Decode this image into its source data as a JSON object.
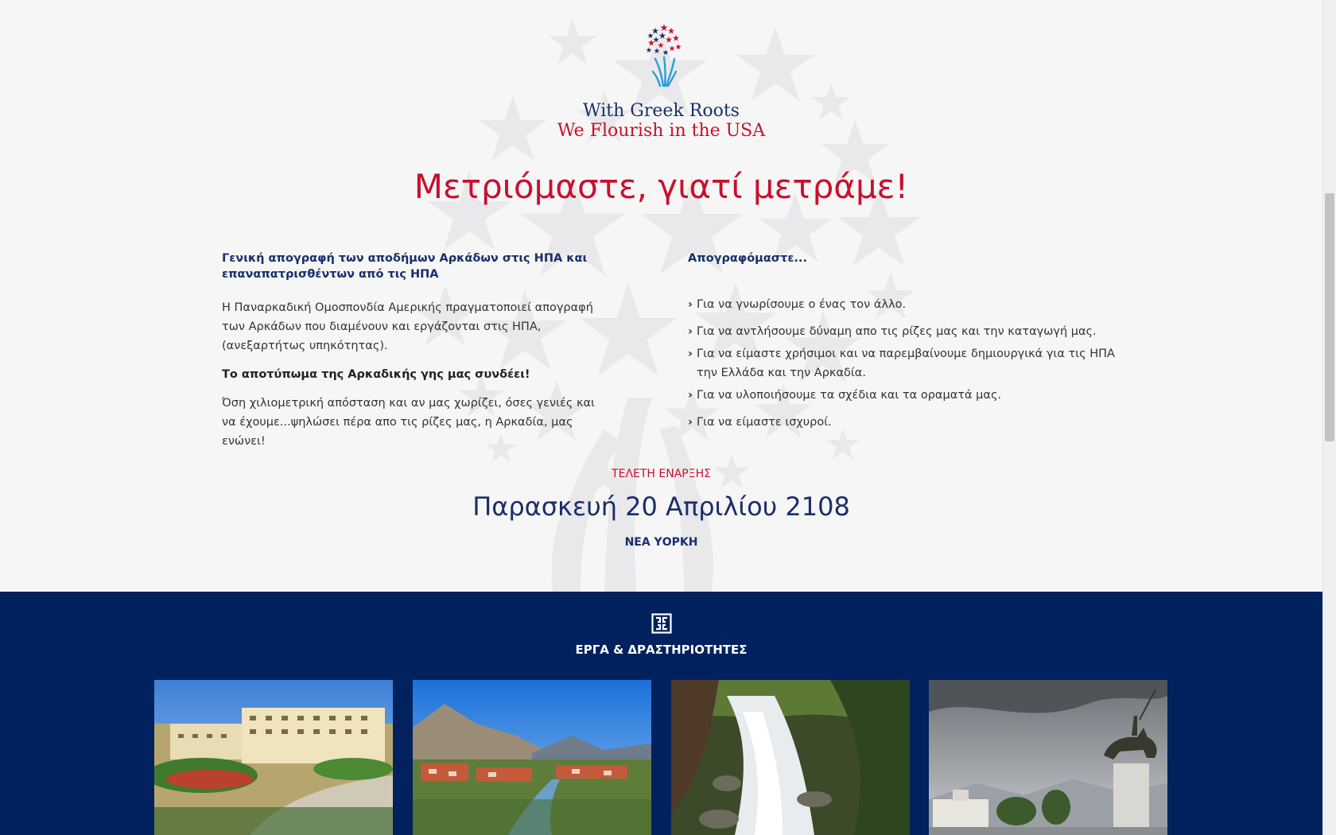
{
  "hero": {
    "tagline_line1": "With Greek Roots",
    "tagline_line2": "We Flourish in the USA",
    "headline": "Μετριόμαστε, γιατί μετράμε!"
  },
  "left_column": {
    "heading": "Γενική απογραφή των αποδήμων Αρκάδων στις ΗΠΑ και επαναπατρισθέντων από τις ΗΠΑ",
    "paragraph1": "Η Παναρκαδική Ομοσπονδία Αμερικής πραγματοποιεί απογραφή των Αρκάδων που διαμένουν και εργάζονται στις ΗΠΑ, (ανεξαρτήτως υπηκότητας).",
    "bold_line": "Το αποτύπωμα της Αρκαδικής γης μας συνδέει!",
    "paragraph2": "Όση χιλιομετρική απόσταση και αν μας χωρίζει, όσες γενιές και να έχουμε...ψηλώσει πέρα απο τις ρίζες μας, η Αρκαδία, μας ενώνει!"
  },
  "right_column": {
    "heading": "Απογραφόμαστε...",
    "items": [
      "Για να γνωρίσουμε ο ένας τον άλλο.",
      "Για να αντλήσουμε δύναμη απο τις ρίζες μας και την καταγωγή μας.",
      "Για να είμαστε χρήσιμοι και να παρεμβαίνουμε δημιουργικά για τις ΗΠΑ την Ελλάδα και την Αρκαδία.",
      "Για να υλοποιήσουμε τα σχέδια και τα οραματά μας.",
      "Για να είμαστε ισχυροί."
    ],
    "bullet_icon": "chevron-right-icon"
  },
  "event": {
    "label": "ΤΕΛΕΤΗ ΕΝΑΡΞΗΣ",
    "date": "Παρασκευή 20 Απριλίου 2108",
    "city": "ΝΕΑ ΥΟΡΚΗ"
  },
  "works": {
    "icon": "greek-key-icon",
    "title": "ΕΡΓΑ & ΔΡΑΣΤΗΡΙΟΤΗΤΕΣ",
    "thumbnails": [
      "building-photo",
      "town-valley-photo",
      "waterfall-photo",
      "statue-square-photo"
    ]
  },
  "colors": {
    "brand_red": "#c8102e",
    "brand_navy": "#1a2e6b",
    "works_background": "#01225e",
    "page_background": "#f6f6f6"
  }
}
